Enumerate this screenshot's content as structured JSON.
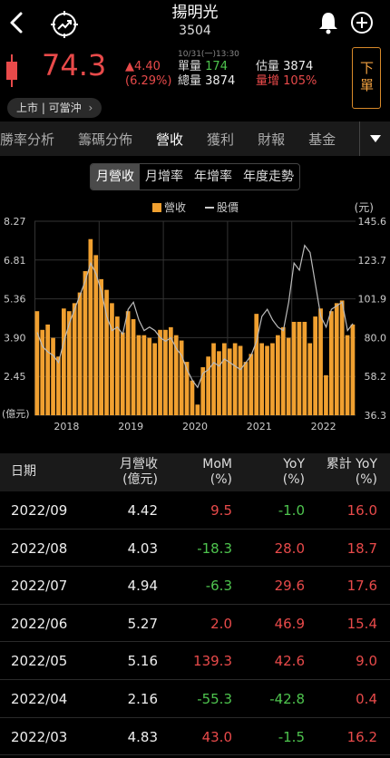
{
  "header": {
    "name": "揚明光",
    "code": "3504"
  },
  "quote": {
    "price": "74.3",
    "change": "▲4.40",
    "change_pct": "(6.29%)",
    "time": "10/31(一)13:30",
    "volume_label": "單量",
    "volume_value": "174",
    "total_label": "總量",
    "total_value": "3874",
    "est_label": "估量",
    "est_value": "3874",
    "increase_label": "量增",
    "increase_value": "105%",
    "status": "上市 | 可當沖",
    "order_label": "下單",
    "colors": {
      "up": "#e84a4a",
      "down": "#4ec44e",
      "accent": "#f0a030"
    }
  },
  "tabs": [
    "勝率分析",
    "籌碼分佈",
    "營收",
    "獲利",
    "財報",
    "基金"
  ],
  "active_tab": 2,
  "segments": [
    "月營收",
    "月增率",
    "年增率",
    "年度走勢"
  ],
  "active_segment": 0,
  "legend": {
    "revenue": "營收",
    "price": "股價",
    "unit_right": "(元)",
    "unit_left": "(億元)"
  },
  "chart_data": {
    "type": "bar",
    "left_axis": {
      "ticks": [
        "8.27",
        "6.81",
        "5.36",
        "3.90",
        "2.45"
      ],
      "ylim": [
        1.0,
        8.27
      ],
      "label": "(億元)"
    },
    "right_axis": {
      "ticks": [
        "145.6",
        "123.7",
        "101.9",
        "80.0",
        "58.2",
        "36.3"
      ],
      "ylim": [
        36.3,
        145.6
      ],
      "label": "(元)"
    },
    "x_ticks": [
      "2018",
      "2019",
      "2020",
      "2021",
      "2022"
    ],
    "series": [
      {
        "name": "營收",
        "color": "#f0a030",
        "values": [
          4.9,
          4.2,
          4.4,
          3.9,
          3.2,
          5.0,
          4.9,
          5.2,
          5.6,
          6.4,
          7.6,
          7.0,
          6.1,
          5.7,
          5.2,
          4.7,
          4.1,
          4.9,
          4.6,
          4.0,
          4.0,
          3.9,
          3.7,
          4.2,
          4.2,
          4.3,
          4.0,
          3.8,
          3.0,
          2.3,
          1.4,
          2.8,
          3.2,
          3.7,
          3.4,
          3.7,
          3.5,
          3.7,
          3.6,
          3.0,
          3.3,
          4.8,
          3.7,
          3.6,
          3.7,
          4.0,
          4.3,
          3.9,
          4.5,
          4.5,
          4.5,
          3.7,
          4.7,
          5.0,
          2.5,
          4.9,
          5.2,
          5.3,
          4.0,
          4.4
        ],
        "highlight_latest": [
          2.16,
          5.16,
          5.27,
          4.94,
          4.03,
          4.42
        ]
      },
      {
        "name": "股價",
        "color": "#bbbbbb",
        "values": [
          83,
          75,
          72,
          70,
          66,
          78,
          88,
          96,
          104,
          112,
          122,
          116,
          106,
          92,
          84,
          86,
          82,
          96,
          100,
          90,
          84,
          86,
          84,
          80,
          78,
          80,
          74,
          70,
          62,
          56,
          52,
          60,
          62,
          66,
          64,
          68,
          66,
          64,
          62,
          66,
          70,
          78,
          92,
          96,
          90,
          86,
          84,
          100,
          122,
          118,
          132,
          128,
          110,
          92,
          86,
          96,
          98,
          100,
          84,
          88
        ]
      }
    ]
  },
  "table": {
    "headers": {
      "date": "日期",
      "rev_a": "月營收",
      "rev_b": "(億元)",
      "mom_a": "MoM",
      "mom_b": "(%)",
      "yoy_a": "YoY",
      "yoy_b": "(%)",
      "cum_a": "累計 YoY",
      "cum_b": "(%)"
    },
    "rows": [
      {
        "date": "2022/09",
        "rev": "4.42",
        "mom": "9.5",
        "yoy": "-1.0",
        "cum": "16.0"
      },
      {
        "date": "2022/08",
        "rev": "4.03",
        "mom": "-18.3",
        "yoy": "28.0",
        "cum": "18.7"
      },
      {
        "date": "2022/07",
        "rev": "4.94",
        "mom": "-6.3",
        "yoy": "29.6",
        "cum": "17.6"
      },
      {
        "date": "2022/06",
        "rev": "5.27",
        "mom": "2.0",
        "yoy": "46.9",
        "cum": "15.4"
      },
      {
        "date": "2022/05",
        "rev": "5.16",
        "mom": "139.3",
        "yoy": "42.6",
        "cum": "9.0"
      },
      {
        "date": "2022/04",
        "rev": "2.16",
        "mom": "-55.3",
        "yoy": "-42.8",
        "cum": "0.4"
      },
      {
        "date": "2022/03",
        "rev": "4.83",
        "mom": "43.0",
        "yoy": "-1.5",
        "cum": "16.2"
      }
    ]
  }
}
